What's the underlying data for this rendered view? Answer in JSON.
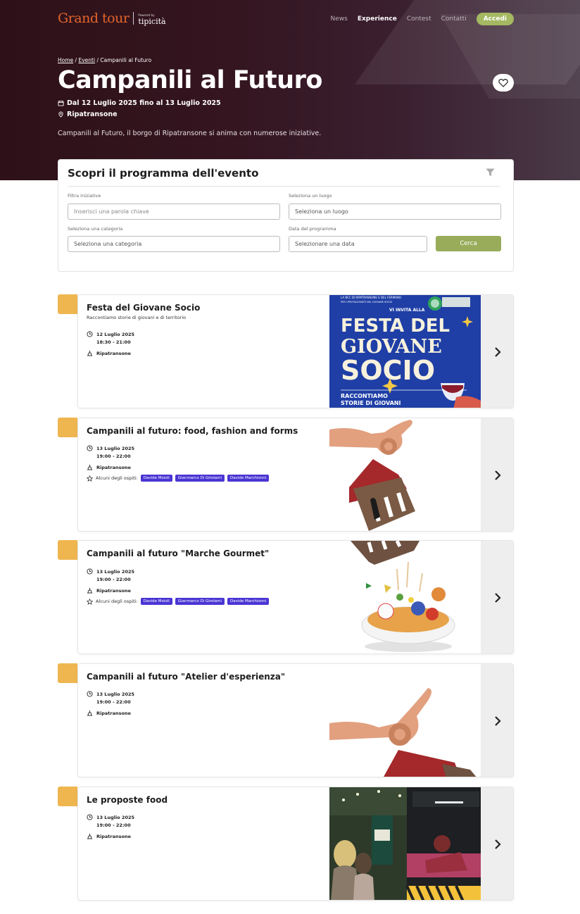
{
  "header": {
    "logo_text": "Grand tour",
    "logo_powered": "Powered by",
    "logo_brand": "tipicità",
    "nav": [
      {
        "label": "News"
      },
      {
        "label": "Experience"
      },
      {
        "label": "Contest"
      },
      {
        "label": "Contatti"
      }
    ],
    "login_label": "Accedi"
  },
  "breadcrumb": {
    "home": "Home",
    "events": "Eventi",
    "current": "Campanili al Futuro",
    "sep": "/"
  },
  "event": {
    "title": "Campanili al Futuro",
    "dates": "Dal 12 Luglio 2025 fino al 13 Luglio 2025",
    "location": "Ripatransone",
    "description": "Campanili al Futuro, il borgo di Ripatransone si anima con numerose iniziative."
  },
  "filters": {
    "heading": "Scopri il programma dell'evento",
    "keyword_label": "Filtra iniziative",
    "keyword_placeholder": "Inserisci una parola chiave",
    "place_label": "Seleziona un luogo",
    "place_value": "Seleziona un luogo",
    "category_label": "Seleziona una categoria",
    "category_value": "Seleziona una categoria",
    "date_label": "Data del programma",
    "date_value": "Selezionare una data",
    "search_label": "Cerca"
  },
  "items": [
    {
      "title": "Festa del Giovane Socio",
      "subtitle": "Raccontiamo storie di giovani e di territorio",
      "date": "12 Luglio 2025",
      "time": "18:30 - 21:00",
      "place": "Ripatransone",
      "poster": {
        "top": "LA BCC DI RIPATRANSONE E DEL FERMANO",
        "top2": "PER I PROTAGONISTI DEL GIOVANE SOCIO",
        "invite": "VI INVITA ALLA",
        "l1": "FESTA DEL",
        "l2": "GIOVANE",
        "l3": "SOCIO",
        "b1": "RACCONTIAMO",
        "b2": "STORIE DI GIOVANI"
      }
    },
    {
      "title": "Campanili al futuro: food, fashion and forms",
      "date": "13 Luglio 2025",
      "time": "19:00 - 22:00",
      "place": "Ripatransone",
      "guests_label": "Alcuni degli ospiti:",
      "guests": [
        "Davide Moioli",
        "Gianmarco Di Girolami",
        "Davide Marchionni"
      ]
    },
    {
      "title": "Campanili al futuro \"Marche Gourmet\"",
      "date": "13 Luglio 2025",
      "time": "19:00 - 22:00",
      "place": "Ripatransone",
      "guests_label": "Alcuni degli ospiti:",
      "guests": [
        "Davide Moioli",
        "Gianmarco Di Girolami",
        "Davide Marchionni"
      ]
    },
    {
      "title": "Campanili al futuro \"Atelier d'esperienza\"",
      "date": "13 Luglio 2025",
      "time": "19:00 - 22:00",
      "place": "Ripatransone"
    },
    {
      "title": "Le proposte food",
      "date": "13 Luglio 2025",
      "time": "19:00 - 22:00",
      "place": "Ripatransone"
    }
  ],
  "colors": {
    "hero_bg": "#2e1118",
    "accent_green": "#98ac5a",
    "tab_orange": "#efb650",
    "chip_purple": "#4a35d4",
    "poster_blue": "#1f3fa6"
  }
}
